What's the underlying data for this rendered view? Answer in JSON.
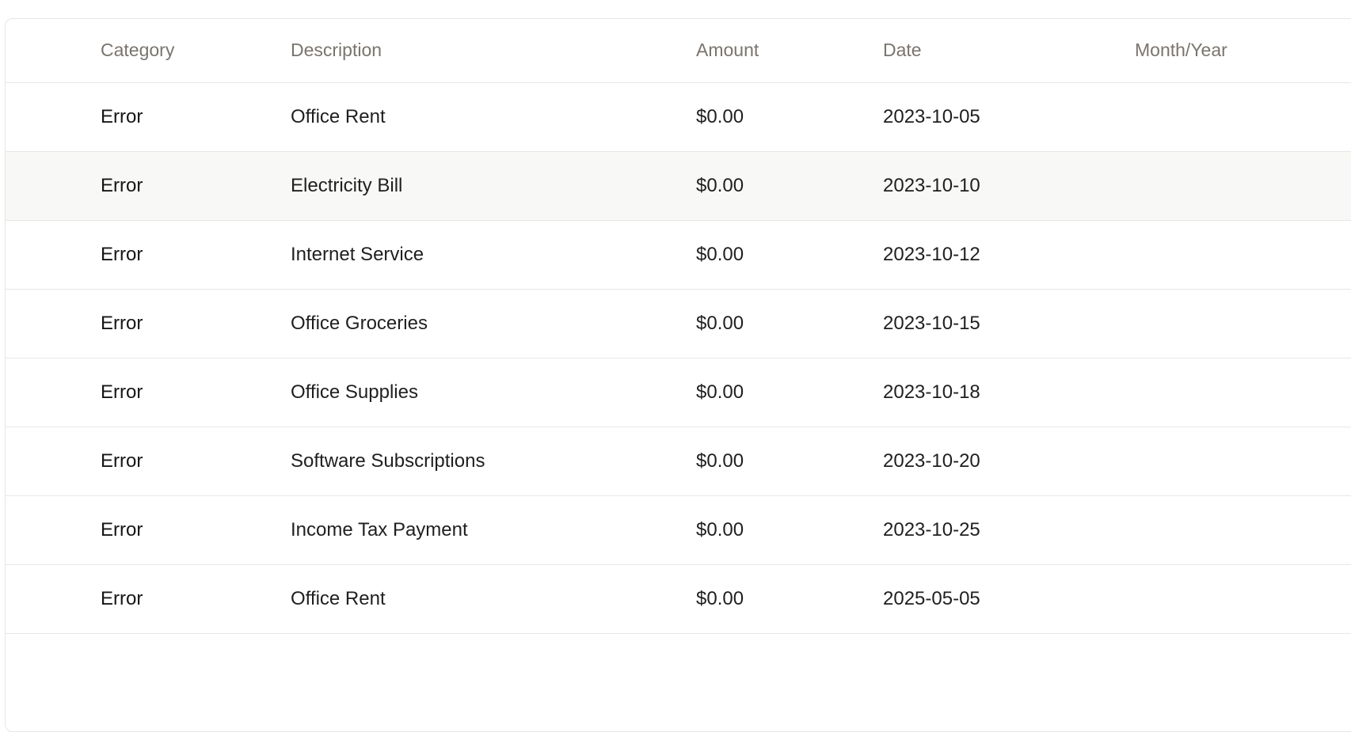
{
  "table": {
    "headers": {
      "category": "Category",
      "description": "Description",
      "amount": "Amount",
      "date": "Date",
      "month_year": "Month/Year"
    },
    "rows": [
      {
        "category": "Error",
        "description": "Office Rent",
        "amount": "$0.00",
        "date": "2023-10-05",
        "month_year": ""
      },
      {
        "category": "Error",
        "description": "Electricity Bill",
        "amount": "$0.00",
        "date": "2023-10-10",
        "month_year": ""
      },
      {
        "category": "Error",
        "description": "Internet Service",
        "amount": "$0.00",
        "date": "2023-10-12",
        "month_year": ""
      },
      {
        "category": "Error",
        "description": "Office Groceries",
        "amount": "$0.00",
        "date": "2023-10-15",
        "month_year": ""
      },
      {
        "category": "Error",
        "description": "Office Supplies",
        "amount": "$0.00",
        "date": "2023-10-18",
        "month_year": ""
      },
      {
        "category": "Error",
        "description": "Software Subscriptions",
        "amount": "$0.00",
        "date": "2023-10-20",
        "month_year": ""
      },
      {
        "category": "Error",
        "description": "Income Tax Payment",
        "amount": "$0.00",
        "date": "2023-10-25",
        "month_year": ""
      },
      {
        "category": "Error",
        "description": "Office Rent",
        "amount": "$0.00",
        "date": "2025-05-05",
        "month_year": ""
      }
    ]
  },
  "colors": {
    "header_text": "#7a746e",
    "row_highlight": "#f8f8f6",
    "border": "#e9e7e4"
  }
}
